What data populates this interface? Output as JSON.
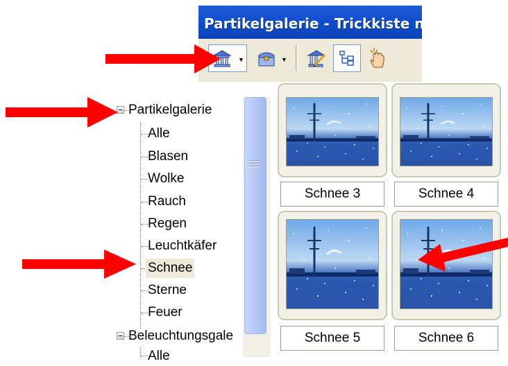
{
  "window": {
    "title": "Partikelgalerie - Trickkiste n"
  },
  "toolbar": {
    "buttons": [
      {
        "icon": "gallery-icon",
        "pressed": true,
        "dropdown": true
      },
      {
        "icon": "chest-icon",
        "pressed": false,
        "dropdown": true
      },
      {
        "icon": "edit-gallery-icon",
        "pressed": false,
        "dropdown": false
      },
      {
        "icon": "tree-view-icon",
        "pressed": true,
        "dropdown": false
      },
      {
        "icon": "hand-pointer-icon",
        "pressed": false,
        "dropdown": false
      }
    ]
  },
  "tree": {
    "root": "Partikelgalerie",
    "children": [
      "Alle",
      "Blasen",
      "Wolke",
      "Rauch",
      "Regen",
      "Leuchtkäfer",
      "Schnee",
      "Sterne",
      "Feuer"
    ],
    "selected": "Schnee",
    "second_root": "Beleuchtungsgale",
    "second_child": "Alle"
  },
  "gallery": {
    "items": [
      "Schnee 3",
      "Schnee 4",
      "Schnee 5",
      "Schnee 6"
    ]
  },
  "annotation": {
    "arrow_color": "#ff0000"
  }
}
